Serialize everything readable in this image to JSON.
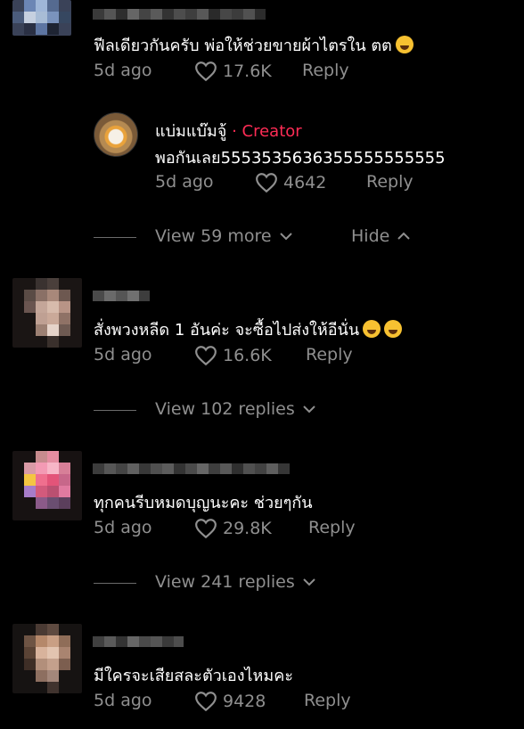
{
  "colors": {
    "background": "#000000",
    "text": "#ffffff",
    "muted": "#8f8f8f",
    "creator_tag": "#fe2c55"
  },
  "comments": [
    {
      "text": "ฟีลเดียวกันครับ พ่อให้ช่วยขายผ้าไตรใน ตต",
      "emoji": "grinning-sweat-emoji",
      "time": "5d ago",
      "likes": "17.6K",
      "reply_label": "Reply"
    },
    {
      "text": "สั่งพวงหลีด 1 อันค่ะ จะซื้อไปส่งให้อีนั่น",
      "emoji": "rolling-laughing-emoji",
      "time": "5d ago",
      "likes": "16.6K",
      "reply_label": "Reply",
      "view_replies": "View 102 replies"
    },
    {
      "text": "ทุกคนรีบหมดบุญนะคะ ช่วยๆกัน",
      "time": "5d ago",
      "likes": "29.8K",
      "reply_label": "Reply",
      "view_replies": "View 241 replies"
    },
    {
      "text": "มีใครจะเสียสละตัวเองไหมคะ",
      "time": "5d ago",
      "likes": "9428",
      "reply_label": "Reply"
    }
  ],
  "creator_reply": {
    "name": "แบ่มแบ๊มจู้",
    "tag": "· Creator",
    "text": "พอกันเลย5553535636355555555555",
    "time": "5d ago",
    "likes": "4642",
    "reply_label": "Reply"
  },
  "thread_controls": {
    "view_more": "View 59 more",
    "hide": "Hide"
  }
}
